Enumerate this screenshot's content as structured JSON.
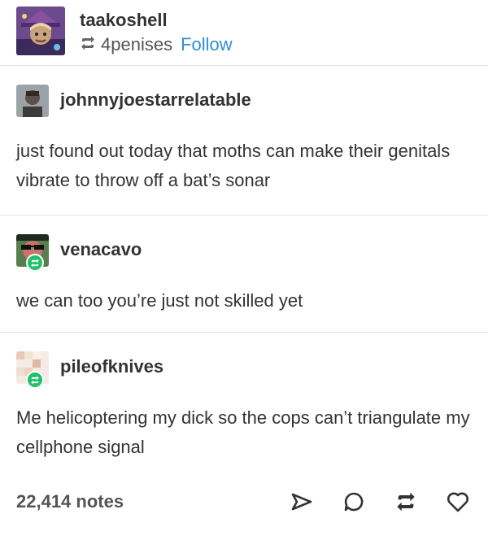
{
  "header": {
    "op_username": "taakoshell",
    "reblog_icon": "reblog-icon",
    "reblogged_from": "4penises",
    "follow_label": "Follow"
  },
  "thread": [
    {
      "username": "johnnyjoestarrelatable",
      "text": "just found out today that moths can make their genitals vibrate to throw off a bat’s sonar"
    },
    {
      "username": "venacavo",
      "text": "we can too you’re just not skilled yet",
      "badge_icon": "reblog-badge-icon"
    },
    {
      "username": "pileofknives",
      "text": "Me helicoptering my dick so the cops can’t triangulate my cellphone signal",
      "badge_icon": "reblog-badge-icon"
    }
  ],
  "footer": {
    "notes": "22,414 notes",
    "actions": [
      "share-icon",
      "reply-icon",
      "reblog-icon",
      "like-icon"
    ]
  },
  "colors": {
    "follow": "#2f8fd8",
    "reblog_badge": "#22c069",
    "divider": "#e3e3e3"
  }
}
